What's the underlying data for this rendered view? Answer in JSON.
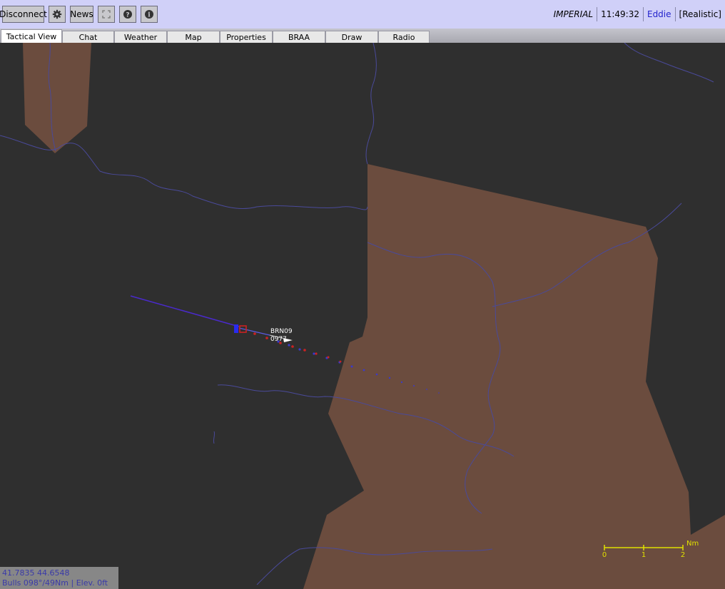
{
  "toolbar": {
    "disconnect_label": "Disconnect",
    "news_label": "News",
    "settings_icon": "gear-icon",
    "fullscreen_icon": "expand-icon",
    "help_icon": "question-icon",
    "info_icon": "info-icon"
  },
  "status": {
    "coalition": "IMPERIAL",
    "time": "11:49:32",
    "user": "Eddie",
    "mode": "[Realistic]"
  },
  "tabs": [
    {
      "label": "Tactical View",
      "active": true
    },
    {
      "label": "Chat",
      "active": false
    },
    {
      "label": "Weather",
      "active": false
    },
    {
      "label": "Map",
      "active": false
    },
    {
      "label": "Properties",
      "active": false
    },
    {
      "label": "BRAA",
      "active": false
    },
    {
      "label": "Draw",
      "active": false
    },
    {
      "label": "Radio",
      "active": false
    }
  ],
  "map": {
    "unit_label_1": "BRN09",
    "unit_label_2": "0977",
    "scale_ticks": [
      "0",
      "1",
      "2"
    ],
    "scale_unit": "Nm",
    "land_color": "#6b4c3e",
    "sea_color": "#2f2f2f",
    "river_color": "#4a4a9a",
    "scale_color": "#e0e000"
  },
  "coords": {
    "latlon": "41.7835 44.6548",
    "bulls": "Bulls 098°/49Nm | Elev. 0ft"
  }
}
